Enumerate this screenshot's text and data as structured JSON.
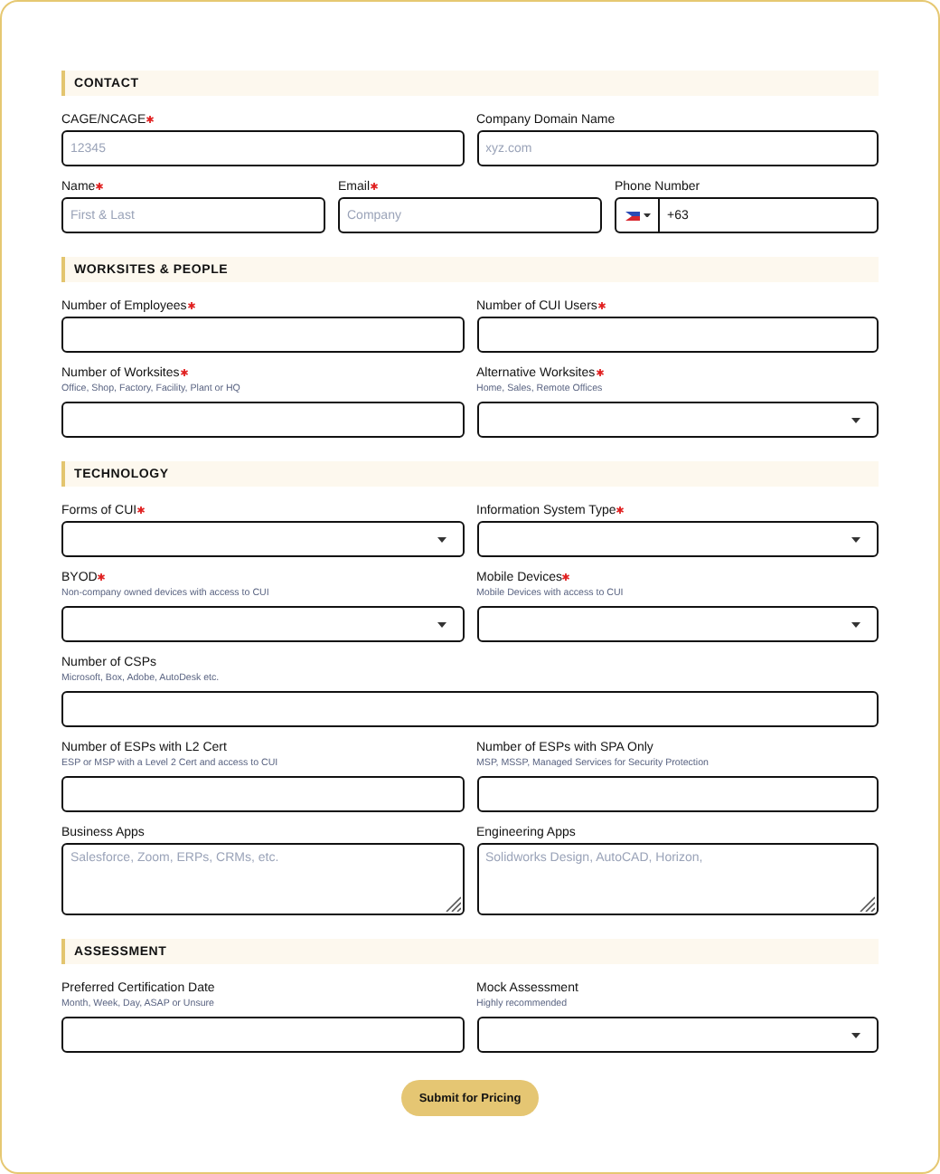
{
  "sections": [
    {
      "title": "CONTACT",
      "rows": [
        {
          "fields": [
            {
              "label": "CAGE/NCAGE",
              "required": true,
              "kind": "text",
              "placeholder": "12345"
            },
            {
              "label": "Company Domain Name",
              "required": false,
              "kind": "text",
              "placeholder": "xyz.com"
            }
          ]
        },
        {
          "fields": [
            {
              "label": "Name",
              "required": true,
              "kind": "text",
              "placeholder": "First & Last"
            },
            {
              "label": "Email",
              "required": true,
              "kind": "text",
              "placeholder": "Company"
            },
            {
              "label": "Phone Number",
              "required": false,
              "kind": "phone",
              "value": "+63"
            }
          ]
        }
      ]
    },
    {
      "title": "WORKSITES & PEOPLE",
      "rows": [
        {
          "fields": [
            {
              "label": "Number of Employees",
              "required": true,
              "kind": "text"
            },
            {
              "label": "Number of CUI Users",
              "required": true,
              "kind": "text"
            }
          ]
        },
        {
          "fields": [
            {
              "label": "Number of Worksites",
              "required": true,
              "hint": "Office, Shop, Factory, Facility, Plant or HQ",
              "kind": "text"
            },
            {
              "label": "Alternative Worksites",
              "required": true,
              "hint": "Home, Sales, Remote Offices",
              "kind": "select"
            }
          ]
        }
      ]
    },
    {
      "title": "TECHNOLOGY",
      "rows": [
        {
          "fields": [
            {
              "label": "Forms of CUI",
              "required": true,
              "kind": "select"
            },
            {
              "label": "Information System Type",
              "required": true,
              "kind": "select"
            }
          ]
        },
        {
          "fields": [
            {
              "label": "BYOD",
              "required": true,
              "hint": "Non-company owned devices with access to CUI",
              "kind": "select"
            },
            {
              "label": "Mobile Devices",
              "required": true,
              "hint": "Mobile Devices with access to CUI",
              "kind": "select"
            }
          ]
        },
        {
          "fields": [
            {
              "label": "Number of CSPs",
              "required": false,
              "hint": "Microsoft, Box, Adobe, AutoDesk etc.",
              "kind": "text"
            }
          ]
        },
        {
          "fields": [
            {
              "label": "Number of ESPs with L2 Cert",
              "required": false,
              "hint": "ESP or MSP with a Level 2 Cert and access to CUI",
              "kind": "text"
            },
            {
              "label": "Number of ESPs with SPA Only",
              "required": false,
              "hint": "MSP, MSSP, Managed Services for Security Protection",
              "kind": "text"
            }
          ]
        },
        {
          "fields": [
            {
              "label": "Business Apps",
              "required": false,
              "kind": "textarea",
              "placeholder": "Salesforce, Zoom, ERPs, CRMs, etc."
            },
            {
              "label": "Engineering Apps",
              "required": false,
              "kind": "textarea",
              "placeholder": "Solidworks Design, AutoCAD, Horizon,"
            }
          ]
        }
      ]
    },
    {
      "title": "ASSESSMENT",
      "rows": [
        {
          "fields": [
            {
              "label": "Preferred Certification Date",
              "required": false,
              "hint": "Month, Week, Day, ASAP or Unsure",
              "kind": "text"
            },
            {
              "label": "Mock Assessment",
              "required": false,
              "hint": "Highly recommended",
              "kind": "select"
            }
          ]
        }
      ]
    }
  ],
  "submit": "Submit for Pricing"
}
